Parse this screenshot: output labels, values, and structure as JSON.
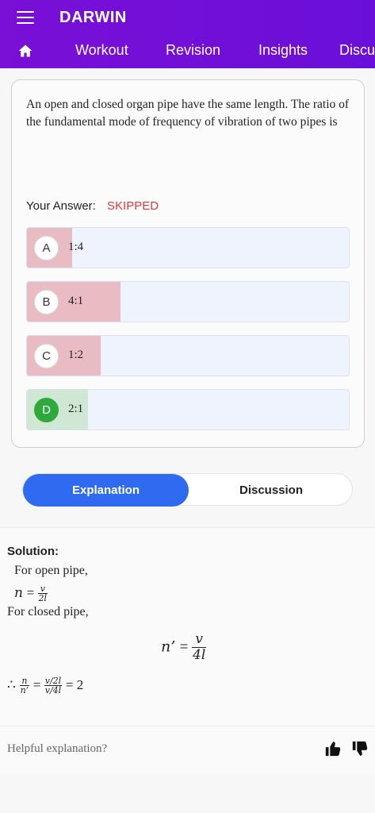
{
  "app": {
    "title": "DARWIN"
  },
  "nav": {
    "tabs": [
      "Workout",
      "Revision",
      "Insights",
      "Discu"
    ]
  },
  "question": {
    "text": "An open and closed organ pipe have the same length. The ratio of the fundamental mode of frequency of vibration of two pipes is",
    "your_answer_label": "Your Answer:",
    "your_answer_value": "SKIPPED",
    "options": [
      {
        "letter": "A",
        "text": "1:4",
        "share": 0.14
      },
      {
        "letter": "B",
        "text": "4:1",
        "share": 0.29
      },
      {
        "letter": "C",
        "text": "1:2",
        "share": 0.23
      },
      {
        "letter": "D",
        "text": "2:1",
        "share": 0.19,
        "correct": true
      }
    ]
  },
  "tabs": {
    "explanation": "Explanation",
    "discussion": "Discussion"
  },
  "solution": {
    "title": "Solution:",
    "line1": "For open pipe,",
    "eq1_lhs": "n",
    "eq1_num": "v",
    "eq1_den": "2l",
    "line2": "For closed pipe,",
    "eq2_lhs": "n’",
    "eq2_num": "v",
    "eq2_den": "4l",
    "eq3_therefore": "∴",
    "eq3_lnum": "n",
    "eq3_lden": "n’",
    "eq3_rnum": "v/2l",
    "eq3_rden": "v/4l",
    "eq3_result": "2"
  },
  "feedback": {
    "prompt": "Helpful explanation?"
  },
  "colors": {
    "header": "#7a0fd6",
    "accent": "#2f6bf0",
    "wrong": "#e9bcc4",
    "correct": "#2eaa3c",
    "skipped": "#e03b3b"
  },
  "icons": {
    "menu": "hamburger-icon",
    "home": "home-icon",
    "like": "thumbs-up-icon",
    "dislike": "thumbs-down-icon"
  }
}
